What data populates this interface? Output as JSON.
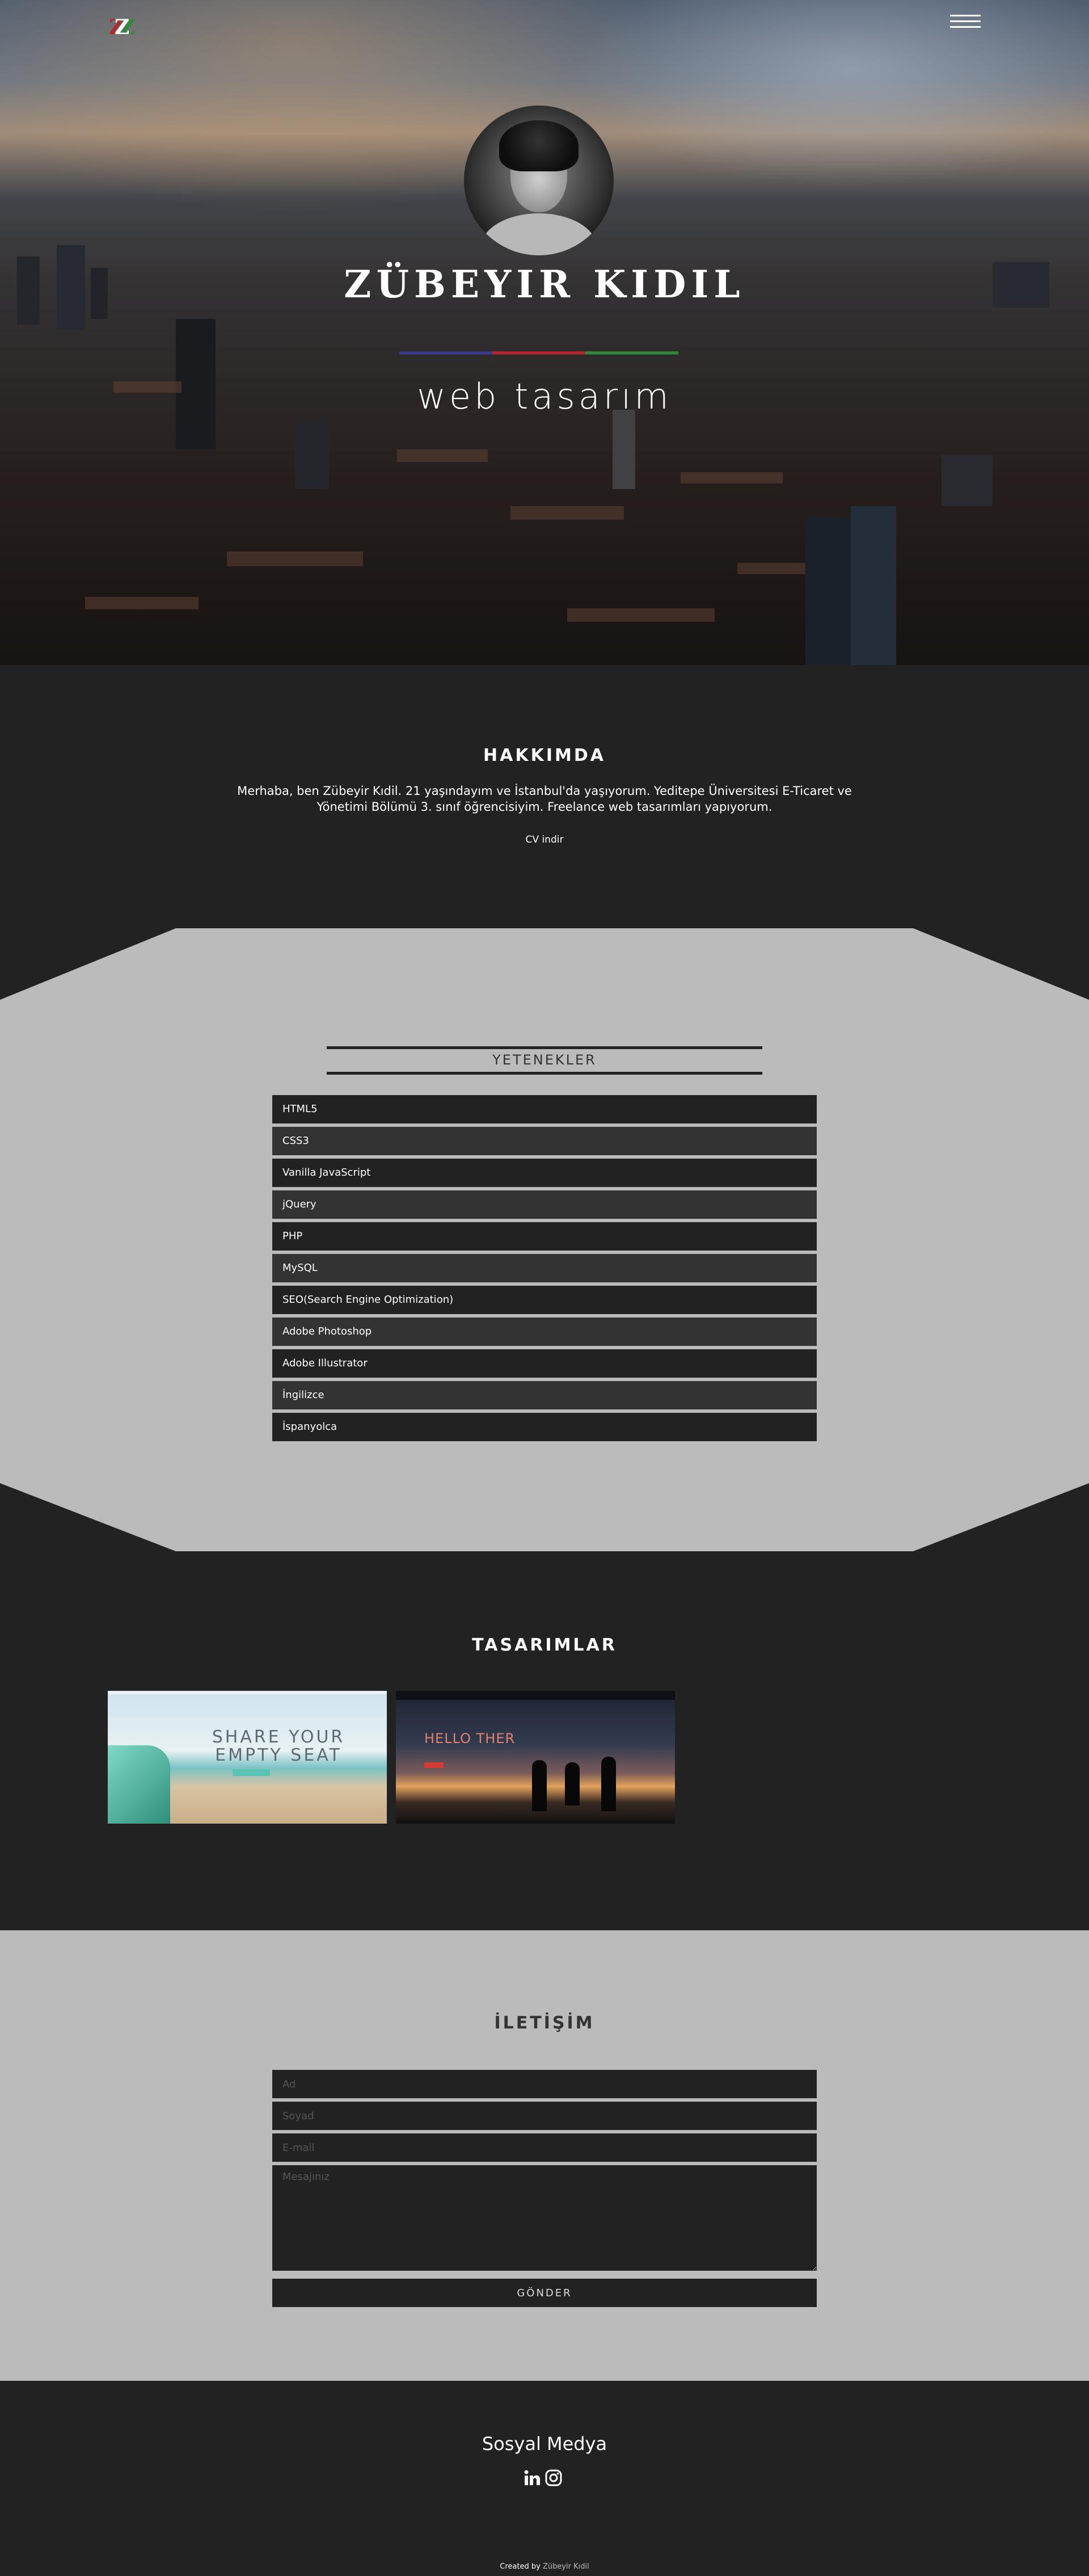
{
  "header": {
    "logo_text": "Z",
    "menu_icon": "hamburger-icon"
  },
  "hero": {
    "name": "ZÜBEYIR KIDIL",
    "role": "web tasarım",
    "avatar_icon": "profile-photo",
    "accent_colors": [
      "#3b3a8c",
      "#b3262d",
      "#2d8a3a"
    ]
  },
  "about": {
    "title": "HAKKIMDA",
    "bio": "Merhaba, ben Zübeyir Kıdil. 21 yaşındayım ve İstanbul'da yaşıyorum. Yeditepe Üniversitesi E-Ticaret ve Yönetimi Bölümü 3. sınıf öğrencisiyim. Freelance web tasarımları yapıyorum.",
    "cv_link": "CV indir"
  },
  "skills": {
    "title": "YETENEKLER",
    "items": [
      "HTML5",
      "CSS3",
      "Vanilla JavaScript",
      "jQuery",
      "PHP",
      "MySQL",
      "SEO(Search Engine Optimization)",
      "Adobe Photoshop",
      "Adobe Illustrator",
      "İngilizce",
      "İspanyolca"
    ]
  },
  "designs": {
    "title": "TASARIMLAR",
    "items": [
      {
        "line1": "SHARE YOUR",
        "line2": "EMPTY SEAT"
      },
      {
        "headline": "HELLO THER"
      }
    ]
  },
  "contact": {
    "title": "İLETİŞİM",
    "name_placeholder": "Ad",
    "surname_placeholder": "Soyad",
    "email_placeholder": "E-mail",
    "message_placeholder": "Mesajınız",
    "submit_label": "GÖNDER"
  },
  "footer": {
    "social_title": "Sosyal Medya",
    "icons": [
      "linkedin-icon",
      "instagram-icon"
    ],
    "credit_prefix": "Created by",
    "credit_name": "Zübeyir Kıdil"
  }
}
